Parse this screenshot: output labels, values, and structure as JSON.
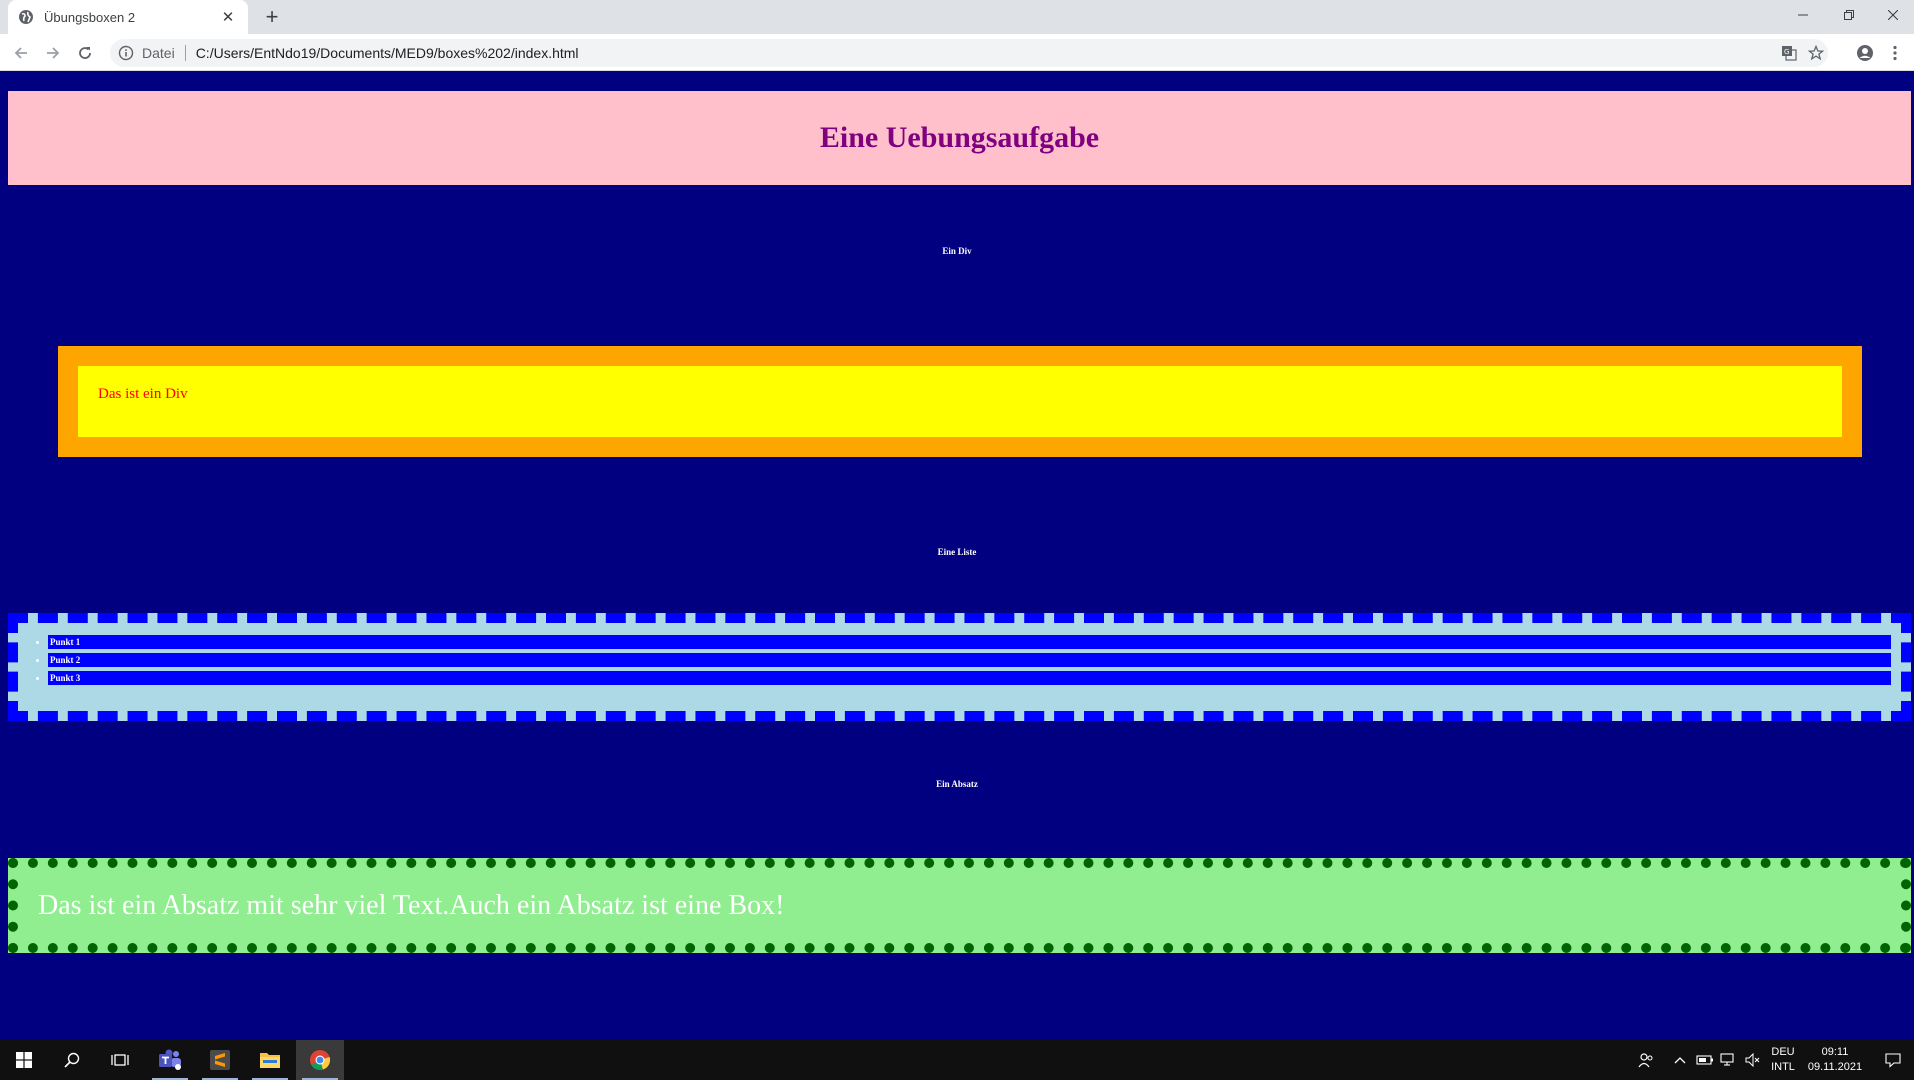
{
  "browser": {
    "tab_title": "Übungsboxen 2",
    "address_scheme": "Datei",
    "address_url": "C:/Users/EntNdo19/Documents/MED9/boxes%202/index.html"
  },
  "page": {
    "header_title": "Eine Uebungsaufgabe",
    "section_div_heading": "Ein Div",
    "div_text": "Das ist ein Div",
    "section_list_heading": "Eine Liste",
    "list_items": [
      "Punkt 1",
      "Punkt 2",
      "Punkt 3"
    ],
    "section_paragraph_heading": "Ein Absatz",
    "paragraph_text": "Das ist ein Absatz mit sehr viel Text.Auch ein Absatz ist eine Box!"
  },
  "taskbar": {
    "language_primary": "DEU",
    "language_secondary": "INTL",
    "time": "09:11",
    "date": "09.11.2021"
  },
  "colors": {
    "page_background": "#000080",
    "header_background": "#ffc0cb",
    "header_text": "#800080",
    "div_border": "#ffa500",
    "div_background": "#ffff00",
    "div_text": "#ff0000",
    "list_border": "#0000ff",
    "list_background": "#add8e6",
    "paragraph_background": "#90ee90",
    "paragraph_border": "#006400"
  }
}
